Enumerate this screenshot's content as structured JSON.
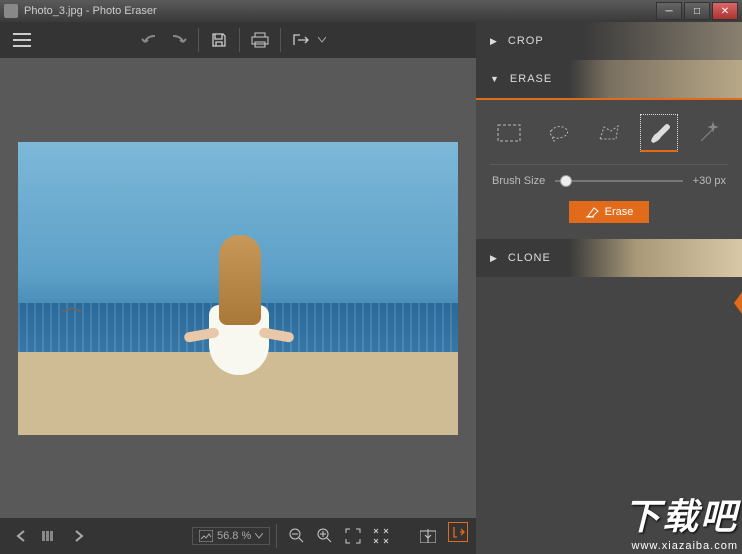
{
  "window": {
    "title": "Photo_3.jpg - Photo Eraser"
  },
  "sections": {
    "crop": "CROP",
    "erase": "ERASE",
    "clone": "CLONE"
  },
  "erase_panel": {
    "tools": {
      "rect": "rectangle-select",
      "lasso": "lasso-select",
      "poly": "polygon-select",
      "brush": "brush",
      "wand": "magic-wand"
    },
    "brush_label": "Brush Size",
    "brush_value": "+30 px",
    "erase_button": "Erase"
  },
  "bottombar": {
    "zoom": "56.8 %"
  },
  "watermark": {
    "big": "下载吧",
    "url": "www.xiazaiba.com"
  }
}
